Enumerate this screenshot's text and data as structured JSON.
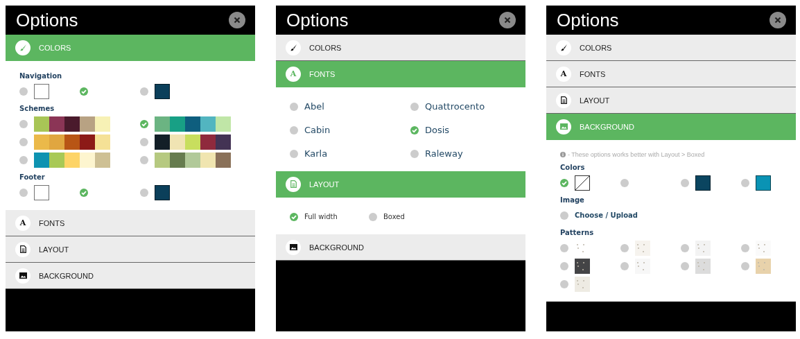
{
  "panels": [
    {
      "title": "Options",
      "sections": [
        {
          "label": "COLORS",
          "expanded": true,
          "groups": [
            {
              "kind": "grid",
              "heading": "Navigation",
              "options": [
                {
                  "kind": "swatch",
                  "color": "#ffffff",
                  "selected": false
                },
                {
                  "kind": "empty",
                  "selected": true
                },
                {
                  "kind": "swatch",
                  "color": "#0b3f5a",
                  "selected": false
                }
              ]
            },
            {
              "kind": "grid",
              "heading": "Schemes",
              "options": [
                {
                  "kind": "scheme",
                  "selected": false,
                  "cells": [
                    {
                      "color": "#a8c556"
                    },
                    {
                      "color": "#8b3556"
                    },
                    {
                      "color": "#4a1a2c"
                    },
                    {
                      "color": "#b8a283"
                    },
                    {
                      "color": "#f7f1b5"
                    }
                  ]
                },
                {
                  "kind": "scheme",
                  "selected": true,
                  "cells": [
                    {
                      "color": "#6bb482"
                    },
                    {
                      "color": "#18a085"
                    },
                    {
                      "color": "#0e5e7e"
                    },
                    {
                      "color": "#52b5c0"
                    },
                    {
                      "color": "#c0e6a7"
                    }
                  ]
                },
                {
                  "kind": "scheme",
                  "selected": false,
                  "cells": [
                    {
                      "color": "#ebb94a"
                    },
                    {
                      "color": "#e0a640"
                    },
                    {
                      "color": "#b85515"
                    },
                    {
                      "color": "#8c1a17"
                    },
                    {
                      "color": "#f5e196"
                    }
                  ]
                },
                {
                  "kind": "scheme",
                  "selected": false,
                  "cells": [
                    {
                      "color": "#131f27"
                    },
                    {
                      "color": "#f0e4b3"
                    },
                    {
                      "color": "#c8de5e"
                    },
                    {
                      "color": "#8f2a3d"
                    },
                    {
                      "color": "#433354"
                    }
                  ]
                },
                {
                  "kind": "scheme",
                  "selected": false,
                  "cells": [
                    {
                      "color": "#0e93b1"
                    },
                    {
                      "color": "#a8c956"
                    },
                    {
                      "color": "#fdd467"
                    },
                    {
                      "color": "#fdf5cf"
                    },
                    {
                      "color": "#cec094"
                    }
                  ]
                },
                {
                  "kind": "scheme",
                  "selected": false,
                  "cells": [
                    {
                      "color": "#b6c980"
                    },
                    {
                      "color": "#667c4f"
                    },
                    {
                      "color": "#b1c999"
                    },
                    {
                      "color": "#f0e5b0"
                    },
                    {
                      "color": "#8a7159"
                    }
                  ]
                }
              ]
            },
            {
              "kind": "grid",
              "heading": "Footer",
              "options": [
                {
                  "kind": "swatch",
                  "color": "#ffffff",
                  "selected": false
                },
                {
                  "kind": "empty",
                  "selected": true
                },
                {
                  "kind": "swatch",
                  "color": "#0b3f5a",
                  "selected": false
                }
              ]
            }
          ]
        },
        {
          "label": "FONTS",
          "icon_char": "A",
          "expanded": false
        },
        {
          "label": "LAYOUT",
          "expanded": false
        },
        {
          "label": "BACKGROUND",
          "expanded": false
        }
      ]
    },
    {
      "title": "Options",
      "sections": [
        {
          "label": "COLORS",
          "expanded": false
        },
        {
          "label": "FONTS",
          "icon_char": "A",
          "expanded": true,
          "groups": [
            {
              "kind": "fonts",
              "options": [
                {
                  "kind": "text",
                  "label": "Abel",
                  "selected": false
                },
                {
                  "kind": "text",
                  "label": "Quattrocento",
                  "selected": false
                },
                {
                  "kind": "text",
                  "label": "Cabin",
                  "selected": false
                },
                {
                  "kind": "text",
                  "label": "Dosis",
                  "selected": true
                },
                {
                  "kind": "text",
                  "label": "Karla",
                  "selected": false
                },
                {
                  "kind": "text",
                  "label": "Raleway",
                  "selected": false
                }
              ]
            }
          ]
        },
        {
          "label": "LAYOUT",
          "expanded": true,
          "groups": [
            {
              "kind": "inline",
              "options": [
                {
                  "kind": "small",
                  "label": "Full width",
                  "selected": true
                },
                {
                  "kind": "small",
                  "label": "Boxed",
                  "selected": false
                }
              ]
            }
          ]
        },
        {
          "label": "BACKGROUND",
          "expanded": false
        }
      ]
    },
    {
      "title": "Options",
      "sections": [
        {
          "label": "COLORS",
          "expanded": false
        },
        {
          "label": "FONTS",
          "icon_char": "A",
          "expanded": false
        },
        {
          "label": "LAYOUT",
          "expanded": false
        },
        {
          "label": "BACKGROUND",
          "expanded": true,
          "groups": [
            {
              "kind": "note",
              "note": "- These options works better with Layout > Boxed"
            },
            {
              "kind": "grid",
              "heading": "Colors",
              "options": [
                {
                  "kind": "transparent",
                  "selected": true
                },
                {
                  "kind": "empty",
                  "selected": false
                },
                {
                  "kind": "swatch",
                  "color": "#0b4560",
                  "selected": false
                },
                {
                  "kind": "swatch",
                  "color": "#0a93b4",
                  "selected": false
                }
              ]
            },
            {
              "kind": "grid",
              "heading": "Image",
              "options": [
                {
                  "kind": "label",
                  "label": "Choose / Upload",
                  "selected": false
                }
              ]
            },
            {
              "kind": "grid",
              "heading": "Patterns",
              "options": [
                {
                  "kind": "pattern",
                  "color": "#ffffff",
                  "selected": false
                },
                {
                  "kind": "pattern",
                  "color": "#f6f3ee",
                  "selected": false
                },
                {
                  "kind": "pattern",
                  "color": "#f3f3f3",
                  "selected": false
                },
                {
                  "kind": "pattern",
                  "color": "#fafafa",
                  "selected": false
                },
                {
                  "kind": "pattern",
                  "color": "#444446",
                  "selected": false
                },
                {
                  "kind": "pattern",
                  "color": "#f7f7f7",
                  "selected": false
                },
                {
                  "kind": "pattern",
                  "color": "#dcdcdc",
                  "selected": false
                },
                {
                  "kind": "pattern",
                  "color": "#e8d2ab",
                  "selected": false
                },
                {
                  "kind": "pattern",
                  "color": "#eeebe3",
                  "selected": false
                }
              ]
            }
          ]
        }
      ]
    }
  ]
}
